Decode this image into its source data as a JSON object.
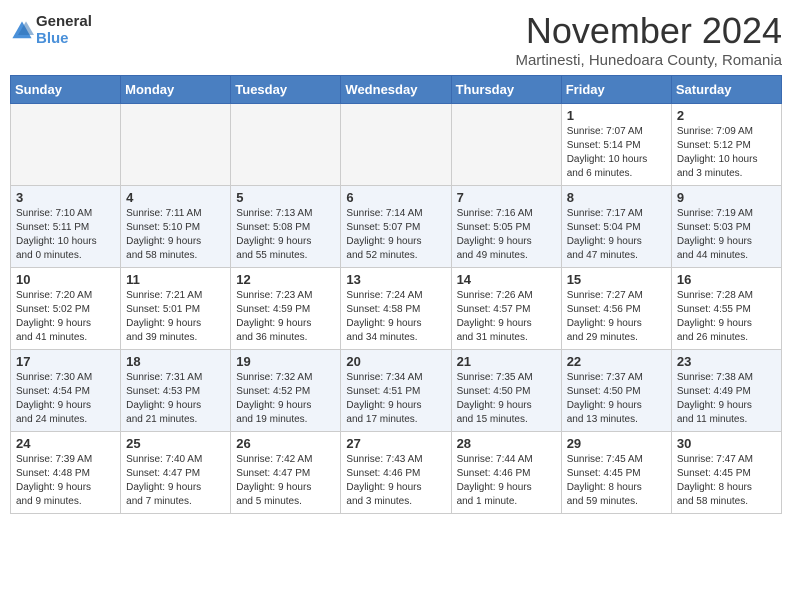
{
  "logo": {
    "general": "General",
    "blue": "Blue"
  },
  "title": "November 2024",
  "subtitle": "Martinesti, Hunedoara County, Romania",
  "weekdays": [
    "Sunday",
    "Monday",
    "Tuesday",
    "Wednesday",
    "Thursday",
    "Friday",
    "Saturday"
  ],
  "weeks": [
    [
      {
        "day": "",
        "info": ""
      },
      {
        "day": "",
        "info": ""
      },
      {
        "day": "",
        "info": ""
      },
      {
        "day": "",
        "info": ""
      },
      {
        "day": "",
        "info": ""
      },
      {
        "day": "1",
        "info": "Sunrise: 7:07 AM\nSunset: 5:14 PM\nDaylight: 10 hours\nand 6 minutes."
      },
      {
        "day": "2",
        "info": "Sunrise: 7:09 AM\nSunset: 5:12 PM\nDaylight: 10 hours\nand 3 minutes."
      }
    ],
    [
      {
        "day": "3",
        "info": "Sunrise: 7:10 AM\nSunset: 5:11 PM\nDaylight: 10 hours\nand 0 minutes."
      },
      {
        "day": "4",
        "info": "Sunrise: 7:11 AM\nSunset: 5:10 PM\nDaylight: 9 hours\nand 58 minutes."
      },
      {
        "day": "5",
        "info": "Sunrise: 7:13 AM\nSunset: 5:08 PM\nDaylight: 9 hours\nand 55 minutes."
      },
      {
        "day": "6",
        "info": "Sunrise: 7:14 AM\nSunset: 5:07 PM\nDaylight: 9 hours\nand 52 minutes."
      },
      {
        "day": "7",
        "info": "Sunrise: 7:16 AM\nSunset: 5:05 PM\nDaylight: 9 hours\nand 49 minutes."
      },
      {
        "day": "8",
        "info": "Sunrise: 7:17 AM\nSunset: 5:04 PM\nDaylight: 9 hours\nand 47 minutes."
      },
      {
        "day": "9",
        "info": "Sunrise: 7:19 AM\nSunset: 5:03 PM\nDaylight: 9 hours\nand 44 minutes."
      }
    ],
    [
      {
        "day": "10",
        "info": "Sunrise: 7:20 AM\nSunset: 5:02 PM\nDaylight: 9 hours\nand 41 minutes."
      },
      {
        "day": "11",
        "info": "Sunrise: 7:21 AM\nSunset: 5:01 PM\nDaylight: 9 hours\nand 39 minutes."
      },
      {
        "day": "12",
        "info": "Sunrise: 7:23 AM\nSunset: 4:59 PM\nDaylight: 9 hours\nand 36 minutes."
      },
      {
        "day": "13",
        "info": "Sunrise: 7:24 AM\nSunset: 4:58 PM\nDaylight: 9 hours\nand 34 minutes."
      },
      {
        "day": "14",
        "info": "Sunrise: 7:26 AM\nSunset: 4:57 PM\nDaylight: 9 hours\nand 31 minutes."
      },
      {
        "day": "15",
        "info": "Sunrise: 7:27 AM\nSunset: 4:56 PM\nDaylight: 9 hours\nand 29 minutes."
      },
      {
        "day": "16",
        "info": "Sunrise: 7:28 AM\nSunset: 4:55 PM\nDaylight: 9 hours\nand 26 minutes."
      }
    ],
    [
      {
        "day": "17",
        "info": "Sunrise: 7:30 AM\nSunset: 4:54 PM\nDaylight: 9 hours\nand 24 minutes."
      },
      {
        "day": "18",
        "info": "Sunrise: 7:31 AM\nSunset: 4:53 PM\nDaylight: 9 hours\nand 21 minutes."
      },
      {
        "day": "19",
        "info": "Sunrise: 7:32 AM\nSunset: 4:52 PM\nDaylight: 9 hours\nand 19 minutes."
      },
      {
        "day": "20",
        "info": "Sunrise: 7:34 AM\nSunset: 4:51 PM\nDaylight: 9 hours\nand 17 minutes."
      },
      {
        "day": "21",
        "info": "Sunrise: 7:35 AM\nSunset: 4:50 PM\nDaylight: 9 hours\nand 15 minutes."
      },
      {
        "day": "22",
        "info": "Sunrise: 7:37 AM\nSunset: 4:50 PM\nDaylight: 9 hours\nand 13 minutes."
      },
      {
        "day": "23",
        "info": "Sunrise: 7:38 AM\nSunset: 4:49 PM\nDaylight: 9 hours\nand 11 minutes."
      }
    ],
    [
      {
        "day": "24",
        "info": "Sunrise: 7:39 AM\nSunset: 4:48 PM\nDaylight: 9 hours\nand 9 minutes."
      },
      {
        "day": "25",
        "info": "Sunrise: 7:40 AM\nSunset: 4:47 PM\nDaylight: 9 hours\nand 7 minutes."
      },
      {
        "day": "26",
        "info": "Sunrise: 7:42 AM\nSunset: 4:47 PM\nDaylight: 9 hours\nand 5 minutes."
      },
      {
        "day": "27",
        "info": "Sunrise: 7:43 AM\nSunset: 4:46 PM\nDaylight: 9 hours\nand 3 minutes."
      },
      {
        "day": "28",
        "info": "Sunrise: 7:44 AM\nSunset: 4:46 PM\nDaylight: 9 hours\nand 1 minute."
      },
      {
        "day": "29",
        "info": "Sunrise: 7:45 AM\nSunset: 4:45 PM\nDaylight: 8 hours\nand 59 minutes."
      },
      {
        "day": "30",
        "info": "Sunrise: 7:47 AM\nSunset: 4:45 PM\nDaylight: 8 hours\nand 58 minutes."
      }
    ]
  ],
  "alt_rows": [
    1,
    3
  ],
  "colors": {
    "header_bg": "#4a7fc1",
    "alt_row_bg": "#e8eef7",
    "empty_bg": "#f5f5f5"
  }
}
